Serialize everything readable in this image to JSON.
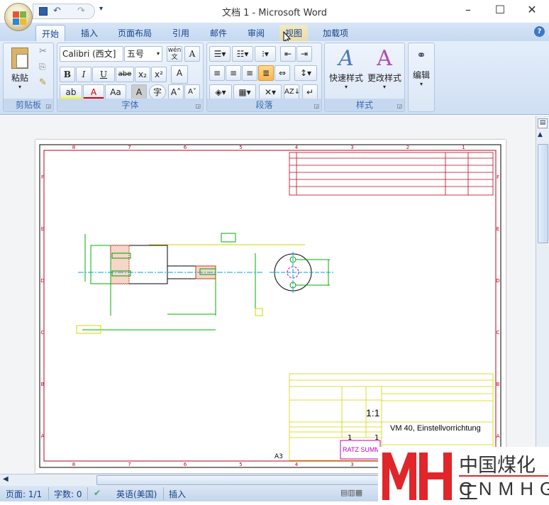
{
  "window": {
    "title": "文档 1 - Microsoft Word",
    "minimize": "–",
    "maximize": "☐",
    "close": "✕"
  },
  "qat": {
    "save": "save-icon",
    "undo": "↶",
    "redo": "↷",
    "customize": "▾"
  },
  "tabs": [
    {
      "label": "开始",
      "active": true
    },
    {
      "label": "插入"
    },
    {
      "label": "页面布局"
    },
    {
      "label": "引用"
    },
    {
      "label": "邮件"
    },
    {
      "label": "审阅"
    },
    {
      "label": "视图",
      "hover": true
    },
    {
      "label": "加载项"
    }
  ],
  "help": "?",
  "ribbon": {
    "clipboard": {
      "label": "剪贴板",
      "paste": "粘贴"
    },
    "font": {
      "label": "字体",
      "font_name": "Calibri (西文]",
      "font_size": "五号",
      "phonetic": "wén 文",
      "border_char": "A",
      "bold": "B",
      "italic": "I",
      "underline": "U",
      "strike": "abe",
      "subscript": "x₂",
      "superscript": "x²",
      "clear": "A",
      "highlight": "ab",
      "font_color": "A",
      "change_case": "Aa",
      "shading": "A",
      "enclose": "字",
      "grow": "A˄",
      "shrink": "A˅"
    },
    "paragraph": {
      "label": "段落",
      "active_align": "justify"
    },
    "styles": {
      "label": "样式",
      "quick": "快速样式",
      "change": "更改样式"
    },
    "editing": {
      "label": "编辑"
    }
  },
  "drawing": {
    "top_cols": [
      "8",
      "7",
      "6",
      "5",
      "4",
      "3",
      "2",
      "1"
    ],
    "bottom_cols": [
      "8",
      "7",
      "6",
      "5",
      "4",
      "3"
    ],
    "rows": [
      "F",
      "E",
      "D",
      "C",
      "B",
      "A"
    ],
    "sheet_size": "A3",
    "scale": "1:1",
    "sheet": "1",
    "sheets": "1",
    "part_name": "VM 40, Einstellvorrichtung",
    "company": "RATZ SUMMER",
    "colors": {
      "frame": "#c0001a",
      "geometry": "#00b000",
      "dimensions": "#d4d400",
      "center": "#00a0e0",
      "hidden": "#c000c0"
    }
  },
  "statusbar": {
    "page": "页面: 1/1",
    "words": "字数: 0",
    "language": "英语(美国)",
    "mode": "插入"
  },
  "watermark": {
    "cn": "中国煤化工",
    "en": "CNMHG"
  }
}
